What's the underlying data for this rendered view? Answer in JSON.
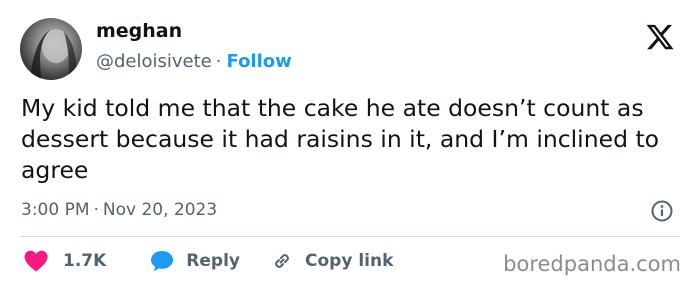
{
  "author": {
    "name": "meghan",
    "handle": "@deloisivete",
    "separator": "·",
    "follow_label": "Follow"
  },
  "tweet": {
    "text": "My kid told me that the cake he ate doesn’t count as dessert because it had raisins in it, and I’m inclined to agree",
    "time": "3:00 PM",
    "separator": "·",
    "date": "Nov 20, 2023"
  },
  "actions": {
    "like_count": "1.7K",
    "reply_label": "Reply",
    "copy_label": "Copy link"
  },
  "watermark": "boredpanda.com",
  "icons": {
    "logo": "x-logo-icon",
    "info": "info-icon",
    "like": "heart-icon",
    "reply": "speech-bubble-icon",
    "copy": "link-icon"
  },
  "colors": {
    "accent": "#1d9bf0",
    "like": "#f91880",
    "secondary_text": "#536471",
    "primary_text": "#0f1419"
  }
}
